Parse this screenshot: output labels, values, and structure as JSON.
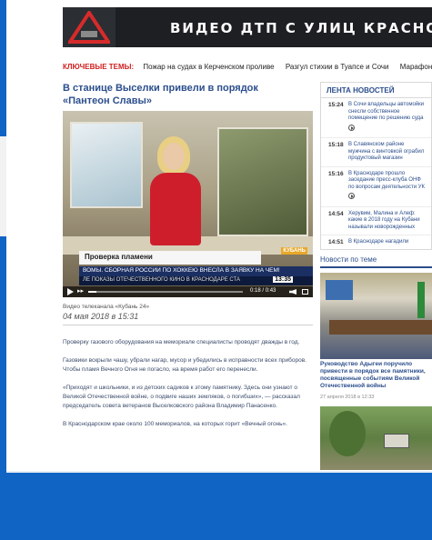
{
  "banner": {
    "title": "ВИДЕО ДТП С УЛИЦ КРАСНОДАРА"
  },
  "topics": {
    "label": "КЛЮЧЕВЫЕ ТЕМЫ:",
    "items": [
      "Пожар на судах в Керченском проливе",
      "Разгул стихии в Туапсе и Сочи",
      "Марафон «Кр"
    ]
  },
  "article": {
    "title": "В станице Выселки привели в порядок «Пантеон Славы»",
    "source": "Видео телеканала «Кубань 24»",
    "date": "04 мая 2018 в 15:31",
    "paragraphs": [
      "Проверку газового оборудования на мемориале специалисты проводят дважды в год.",
      "Газовики вскрыли чашу, убрали нагар, мусор и убедились в исправности всех приборов. Чтобы пламя Вечного Огня не погасло, на время работ его перенесли.",
      "«Приходят и школьники, и из детских садиков к этому памятнику. Здесь они узнают о Великой Отечественной войне, о подвиге наших земляков, о погибших», — рассказал председатель совета ветеранов Выселковского района Владимир Панасенко.",
      "В Краснодарском крае около 100 мемориалов, на которых горит «Вечный огонь»."
    ]
  },
  "video": {
    "lower_third": "Проверка пламени",
    "ticker": "ВОМЫ.  СБОРНАЯ РОССИИ ПО ХОККЕЮ ВНЕСЛА В ЗАЯВКУ НА ЧЕМ!",
    "ticker2": "ЛЕ ПОКАЗЫ ОТЕЧЕСТВЕННОГО КИНО   В КРАСНОДАРЕ СТА",
    "clock": "13:35",
    "elapsed": "0:18",
    "duration": "0:43",
    "progress": 0.05,
    "channel_bug": "КУБАНЬ"
  },
  "news_feed": {
    "header": "ЛЕНТА НОВОСТЕЙ",
    "items": [
      {
        "time": "15:24",
        "text": "В Сочи владельцы автомойки снесли собственное помещение по решению суда",
        "has_video": true
      },
      {
        "time": "15:18",
        "text": "В Славянском районе мужчина с винтовкой ограбил продуктовый магазин",
        "has_video": false
      },
      {
        "time": "15:16",
        "text": "В Краснодаре прошло заседание пресс-клуба ОНФ по вопросам деятельности УК",
        "has_video": true
      },
      {
        "time": "14:54",
        "text": "Херувим, Малина и Алеф: какие в 2018 году на Кубани называли новорожденных",
        "has_video": false
      },
      {
        "time": "14:51",
        "text": "В Краснодаре нагадили",
        "has_video": false
      }
    ]
  },
  "related": {
    "header": "Новости по теме",
    "item1_title": "Руководство Адыгеи поручило привести в порядок все памятники, посвященные событиям Великой Отечественной войны",
    "item1_date": "27 апреля 2018 в 12:33"
  },
  "colors": {
    "page_background": "#0f64c4",
    "link_blue": "#2b4e8c",
    "topics_label_red": "#d01e1e"
  }
}
